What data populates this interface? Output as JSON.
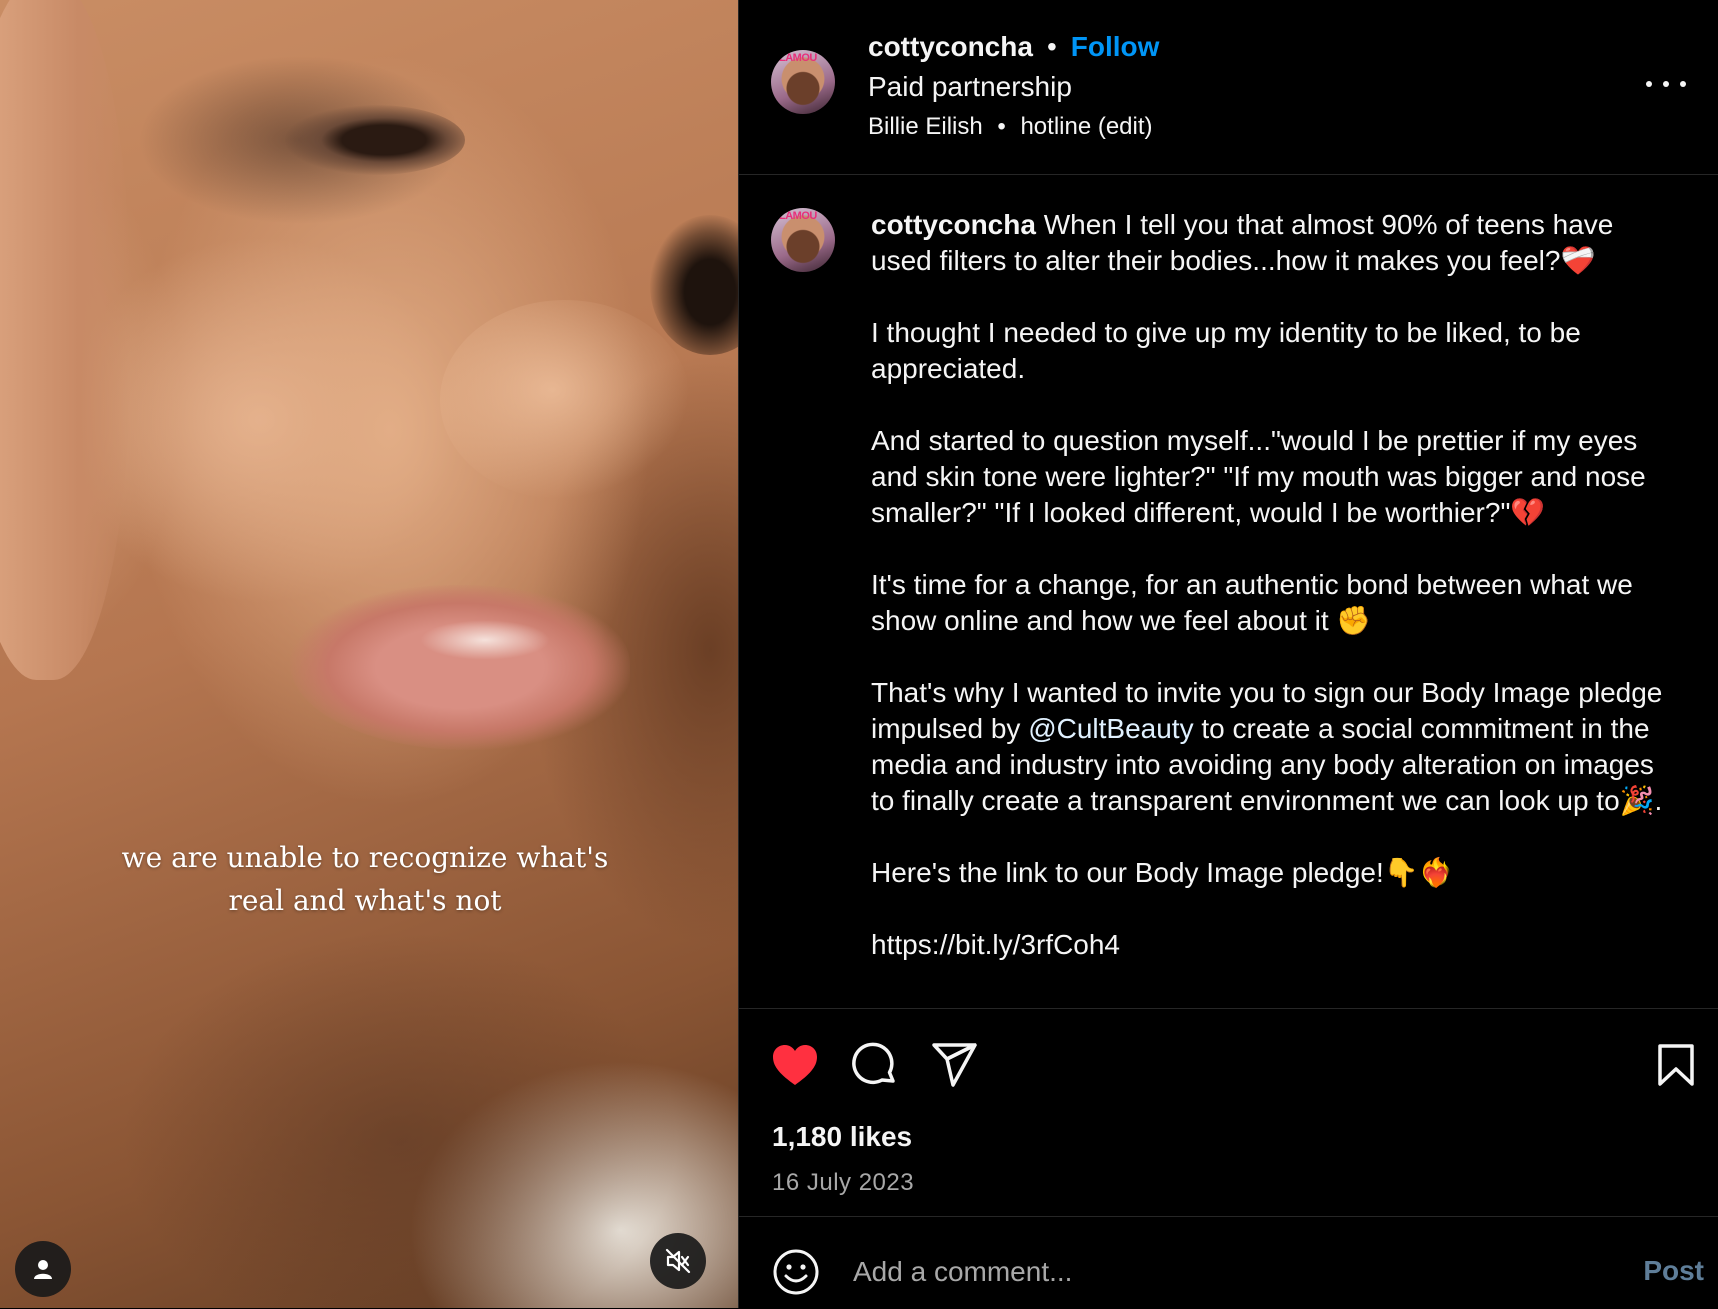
{
  "media": {
    "caption_lines": [
      "we are unable to recognize what's",
      "real and what's not"
    ],
    "icons": {
      "user": "user-icon",
      "mute": "speaker-muted-icon"
    }
  },
  "header": {
    "username": "cottyconcha",
    "separator": "•",
    "follow_label": "Follow",
    "paid_partnership": "Paid partnership",
    "audio_artist": "Billie Eilish",
    "audio_track": "hotline (edit)",
    "avatar_text": "LAMOU",
    "more_icon": "more-options-icon"
  },
  "caption": {
    "username": "cottyconcha",
    "p1": " When I tell you that almost 90% of teens have used filters to alter their bodies...how it makes you feel?❤️‍🩹",
    "p2": "I thought I needed to give up my identity to be liked, to be appreciated.",
    "p3": "And started to question myself...\"would I be prettier if my eyes and skin tone were lighter?\" \"If my mouth was bigger and nose smaller?\" \"If I looked different, would I be worthier?\"💔",
    "p4": "It's time for a change, for an authentic bond between what we show online and how we feel about it ✊",
    "p5_before": "That's why I wanted to invite you to sign our Body Image pledge impulsed by ",
    "p5_mention": "@CultBeauty",
    "p5_after": " to create a social commitment in the media and industry into avoiding any body alteration on images to finally create a transparent environment we can look up to🎉.",
    "p6": "Here's the link to our Body Image pledge!👇❤️‍🔥",
    "p7": "https://bit.ly/3rfCoh4"
  },
  "actions": {
    "likes": "1,180 likes",
    "date": "16 July 2023",
    "like_color": "#ff3040",
    "icons": [
      "heart-icon",
      "comment-icon",
      "share-icon",
      "bookmark-icon"
    ]
  },
  "comment": {
    "placeholder": "Add a comment...",
    "post_label": "Post",
    "emoji_icon": "emoji-icon"
  },
  "colors": {
    "background": "#000000",
    "text": "#f5f5f5",
    "link": "#0095f6",
    "muted": "#a8a8a8",
    "divider": "#262626"
  }
}
